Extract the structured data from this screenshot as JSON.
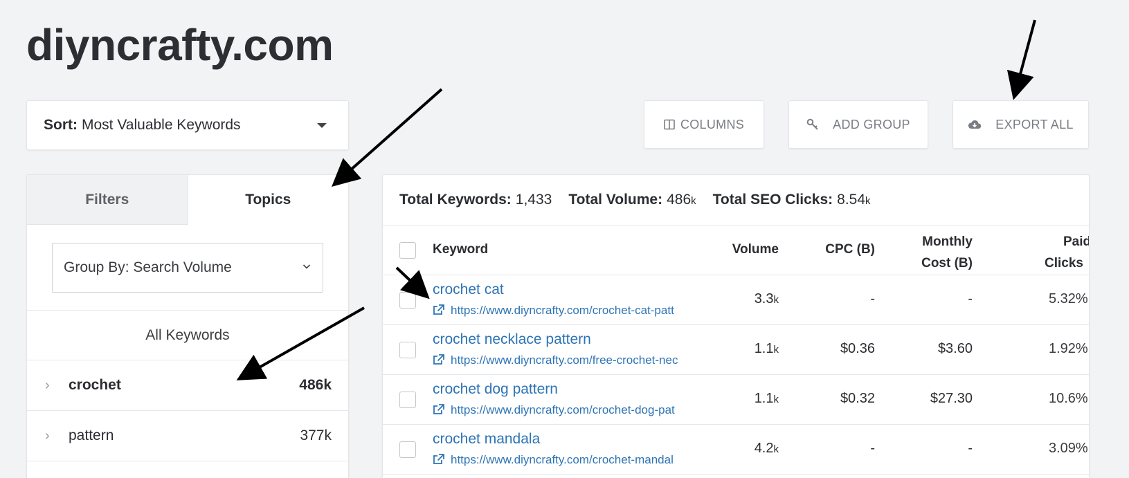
{
  "site": {
    "title": "diyncrafty.com"
  },
  "sort": {
    "key_label": "Sort:",
    "value": "Most Valuable Keywords"
  },
  "toolbar": {
    "columns_label": "COLUMNS",
    "add_group_label": "ADD GROUP",
    "export_all_label": "EXPORT ALL"
  },
  "left_panel": {
    "tabs": [
      {
        "label": "Filters",
        "active": false
      },
      {
        "label": "Topics",
        "active": true
      }
    ],
    "group_by": "Group By: Search Volume",
    "all_keywords": "All Keywords",
    "topics": [
      {
        "name": "crochet",
        "count": "486k",
        "active": true
      },
      {
        "name": "pattern",
        "count": "377k",
        "active": false
      }
    ]
  },
  "totals": {
    "keywords_label": "Total Keywords:",
    "keywords_value": "1,433",
    "volume_label": "Total Volume:",
    "volume_value": "486",
    "volume_suffix": "k",
    "seo_label": "Total SEO Clicks:",
    "seo_value": "8.54",
    "seo_suffix": "k"
  },
  "table": {
    "headers": {
      "keyword": "Keyword",
      "volume": "Volume",
      "cpc": "CPC (B)",
      "monthly_line1": "Monthly",
      "monthly_line2": "Cost (B)",
      "paid_line1": "Paid",
      "paid_line2": "Clicks"
    },
    "rows": [
      {
        "keyword": "crochet cat",
        "url": "https://www.diyncrafty.com/crochet-cat-patt",
        "volume": "3.3",
        "volume_suffix": "k",
        "cpc": "-",
        "monthly_cost": "-",
        "paid_clicks": "5.32%"
      },
      {
        "keyword": "crochet necklace pattern",
        "url": "https://www.diyncrafty.com/free-crochet-nec",
        "volume": "1.1",
        "volume_suffix": "k",
        "cpc": "$0.36",
        "monthly_cost": "$3.60",
        "paid_clicks": "1.92%"
      },
      {
        "keyword": "crochet dog pattern",
        "url": "https://www.diyncrafty.com/crochet-dog-pat",
        "volume": "1.1",
        "volume_suffix": "k",
        "cpc": "$0.32",
        "monthly_cost": "$27.30",
        "paid_clicks": "10.6%"
      },
      {
        "keyword": "crochet mandala",
        "url": "https://www.diyncrafty.com/crochet-mandal",
        "volume": "4.2",
        "volume_suffix": "k",
        "cpc": "-",
        "monthly_cost": "-",
        "paid_clicks": "3.09%"
      }
    ]
  },
  "colors": {
    "link": "#2d74b5",
    "background": "#f2f3f5",
    "annotation_arrow": "#000000"
  },
  "icons": [
    "columns-icon",
    "key-icon",
    "cloud-download-icon",
    "caret-down-icon",
    "chevron-down-icon",
    "chevron-right-icon",
    "external-link-icon",
    "annotation-arrow"
  ]
}
